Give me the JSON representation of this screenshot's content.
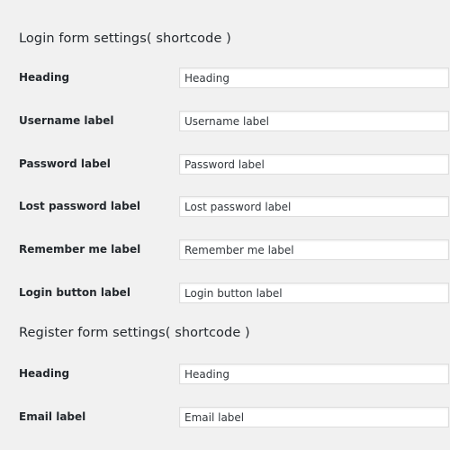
{
  "login_section": {
    "title": "Login form settings( shortcode )",
    "fields": [
      {
        "label": "Heading",
        "value": "Heading"
      },
      {
        "label": "Username label",
        "value": "Username label"
      },
      {
        "label": "Password label",
        "value": "Password label"
      },
      {
        "label": "Lost password label",
        "value": "Lost password label"
      },
      {
        "label": "Remember me label",
        "value": "Remember me label"
      },
      {
        "label": "Login button label",
        "value": "Login button label"
      }
    ]
  },
  "register_section": {
    "title": "Register form settings( shortcode )",
    "fields": [
      {
        "label": "Heading",
        "value": "Heading"
      },
      {
        "label": "Email label",
        "value": "Email label"
      }
    ]
  }
}
